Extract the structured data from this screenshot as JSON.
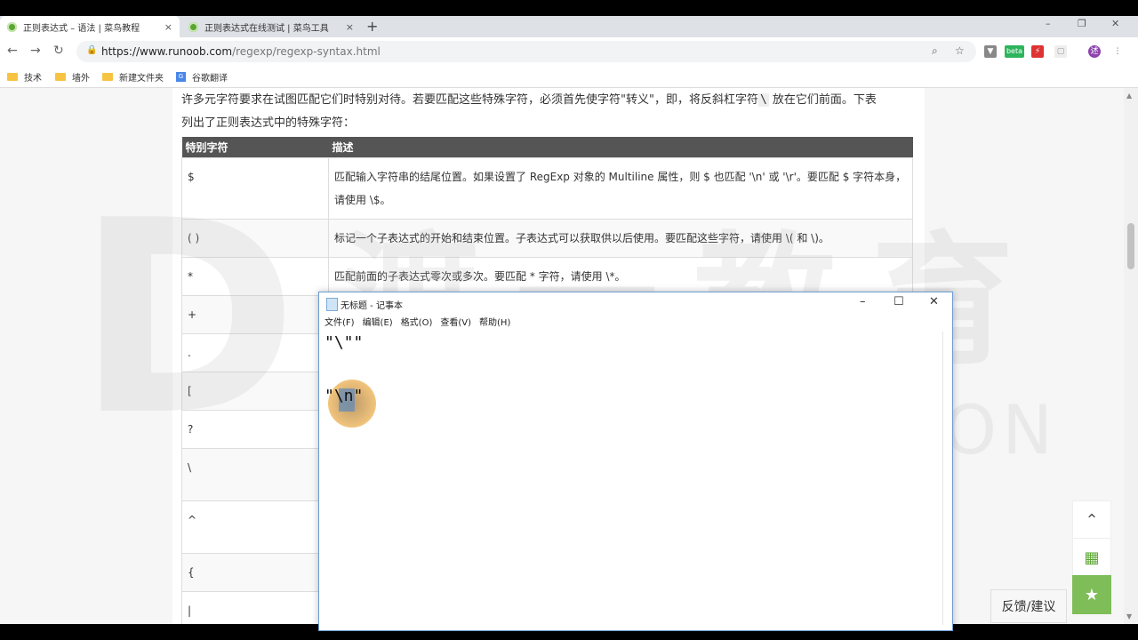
{
  "browser": {
    "tabs": [
      {
        "label": "正则表达式 – 语法 | 菜鸟教程",
        "active": true
      },
      {
        "label": "正则表达式在线测试 | 菜鸟工具",
        "active": false
      }
    ],
    "new_tab_glyph": "+",
    "close_glyph": "×",
    "window_controls": [
      "–",
      "❐",
      "✕"
    ],
    "url_host": "https://www.runoob.com",
    "url_path": "/regexp/regexp-syntax.html",
    "nav": {
      "back": "←",
      "forward": "→",
      "reload": "↻"
    },
    "bookmarks": [
      "技术",
      "墙外",
      "新建文件夹",
      "谷歌翻译"
    ],
    "extensions": {
      "beta_badge": "beta",
      "profile_initial": "述"
    }
  },
  "page": {
    "intro_line1": "许多元字符要求在试图匹配它们时特别对待。若要匹配这些特殊字符，必须首先使字符\"转义\"，即，将反斜杠字符",
    "intro_code": "\\",
    "intro_line1b": " 放在它们前面。下表",
    "intro_line2": "列出了正则表达式中的特殊字符：",
    "table_headers": [
      "特别字符",
      "描述"
    ],
    "rows": [
      {
        "char": "$",
        "desc": "匹配输入字符串的结尾位置。如果设置了 RegExp 对象的 Multiline 属性，则 $ 也匹配 '\\n' 或 '\\r'。要匹配 $ 字符本身，请使用 \\$。"
      },
      {
        "char": "( )",
        "desc": "标记一个子表达式的开始和结束位置。子表达式可以获取供以后使用。要匹配这些字符，请使用 \\( 和 \\)。"
      },
      {
        "char": "*",
        "desc": "匹配前面的子表达式零次或多次。要匹配 * 字符，请使用 \\*。"
      },
      {
        "char": "+",
        "desc": ""
      },
      {
        "char": ".",
        "desc": ""
      },
      {
        "char": "[",
        "desc": ""
      },
      {
        "char": "?",
        "desc": ""
      },
      {
        "char": "\\",
        "desc": ""
      },
      {
        "char": "^",
        "desc": ""
      },
      {
        "char": "{",
        "desc": ""
      },
      {
        "char": "|",
        "desc": ""
      }
    ],
    "feedback": "反馈/建议",
    "watermark": "DUYI EDUCATION",
    "watermark_cn": "渡一教育"
  },
  "notepad": {
    "title": "无标题 - 记事本",
    "menu": [
      "文件(F)",
      "编辑(E)",
      "格式(O)",
      "查看(V)",
      "帮助(H)"
    ],
    "line1": "\"\\\"\"",
    "line2": "\"\\n\""
  },
  "colors": {
    "brand": "#5aa632",
    "header_bg": "#555555",
    "star_bg": "#7fbd59"
  }
}
